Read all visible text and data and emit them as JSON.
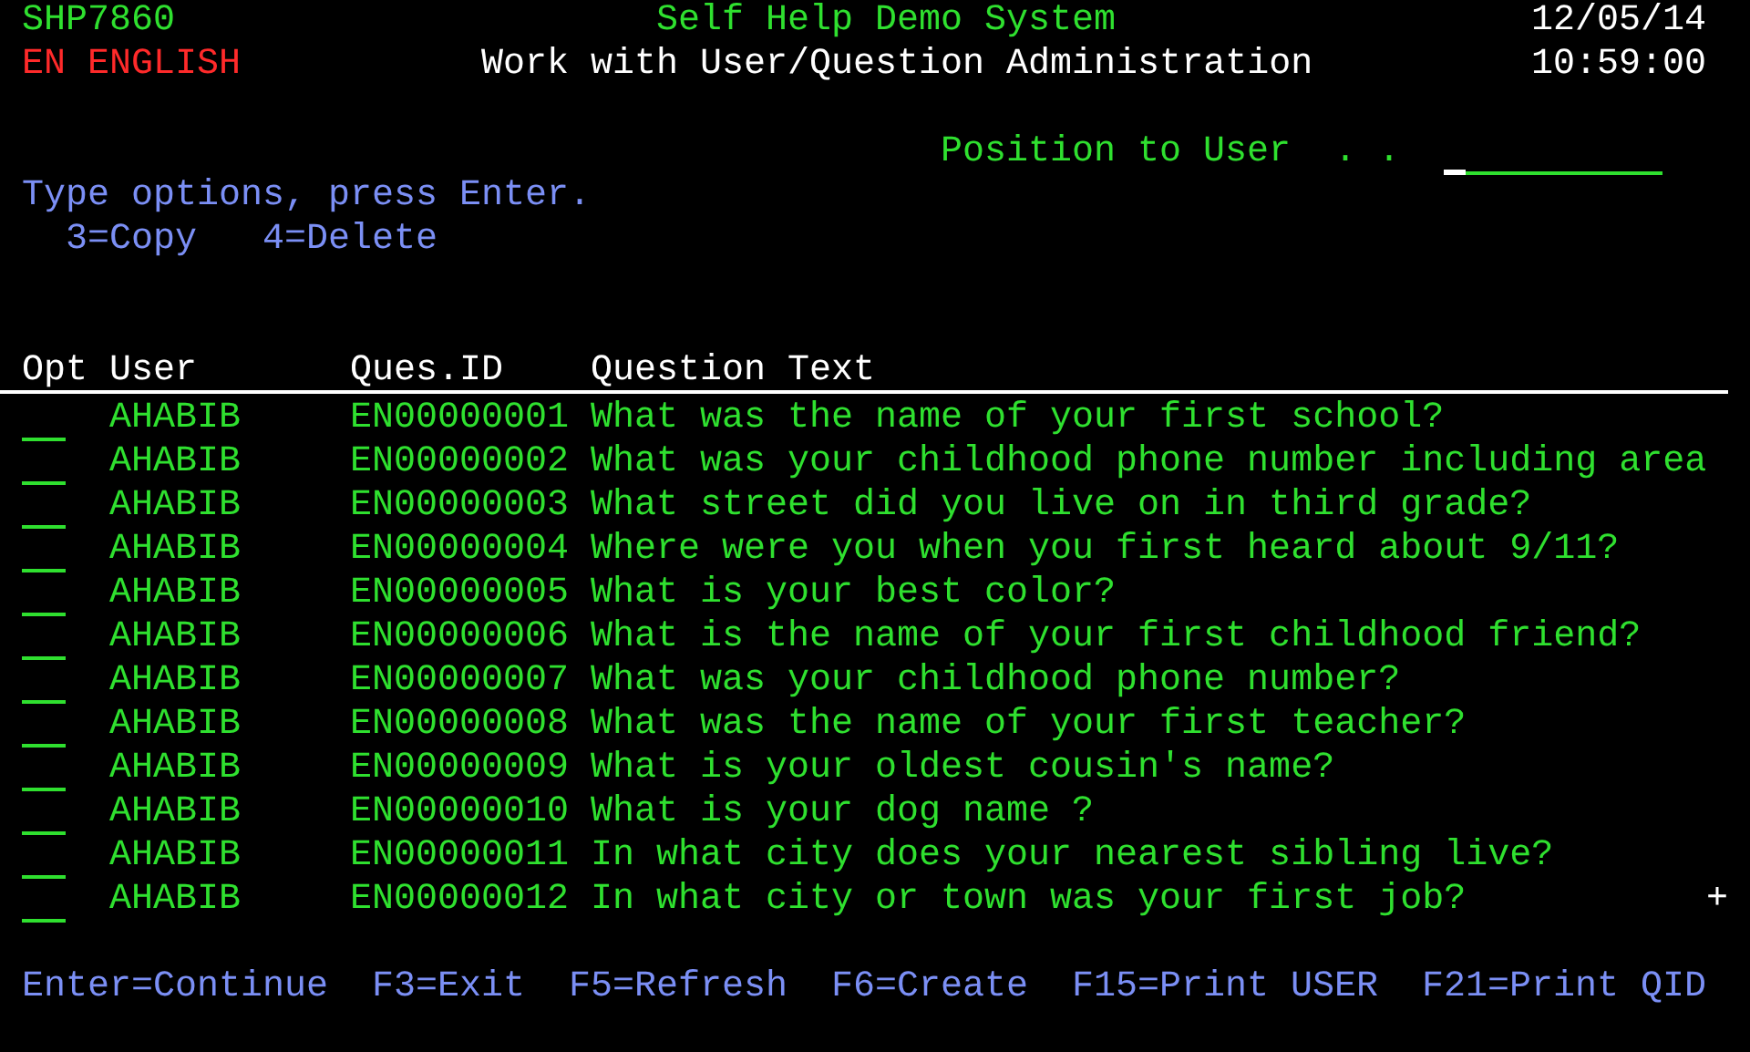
{
  "header": {
    "program": "SHP7860",
    "system_title": "Self Help Demo System",
    "date": "12/05/14",
    "language": "EN ENGLISH",
    "screen_title": "Work with User/Question Administration",
    "time": "10:59:00"
  },
  "position": {
    "label": "Position to User  . ."
  },
  "instructions": {
    "text": "Type options, press Enter.",
    "options": [
      "3=Copy",
      "4=Delete"
    ]
  },
  "table": {
    "columns": [
      "Opt",
      "User",
      "Ques.ID",
      "Question Text"
    ],
    "rows": [
      {
        "user": "AHABIB",
        "id": "EN00000001",
        "text": "What was the name of your first school?"
      },
      {
        "user": "AHABIB",
        "id": "EN00000002",
        "text": "What was your childhood phone number including area"
      },
      {
        "user": "AHABIB",
        "id": "EN00000003",
        "text": "What street did you live on in third grade?"
      },
      {
        "user": "AHABIB",
        "id": "EN00000004",
        "text": "Where were you when you first heard about 9/11?"
      },
      {
        "user": "AHABIB",
        "id": "EN00000005",
        "text": "What is your best color?"
      },
      {
        "user": "AHABIB",
        "id": "EN00000006",
        "text": "What is the name of your first childhood friend?"
      },
      {
        "user": "AHABIB",
        "id": "EN00000007",
        "text": "What was your childhood phone number?"
      },
      {
        "user": "AHABIB",
        "id": "EN00000008",
        "text": "What was the name of your first teacher?"
      },
      {
        "user": "AHABIB",
        "id": "EN00000009",
        "text": "What is your oldest cousin's name?"
      },
      {
        "user": "AHABIB",
        "id": "EN00000010",
        "text": "What is your dog name ?"
      },
      {
        "user": "AHABIB",
        "id": "EN00000011",
        "text": "In what city does your nearest sibling live?"
      },
      {
        "user": "AHABIB",
        "id": "EN00000012",
        "text": "In what city or town was your first job?"
      }
    ],
    "more_indicator": "+"
  },
  "function_keys": [
    "Enter=Continue",
    "F3=Exit",
    "F5=Refresh",
    "F6=Create",
    "F15=Print USER",
    "F21=Print QID"
  ]
}
